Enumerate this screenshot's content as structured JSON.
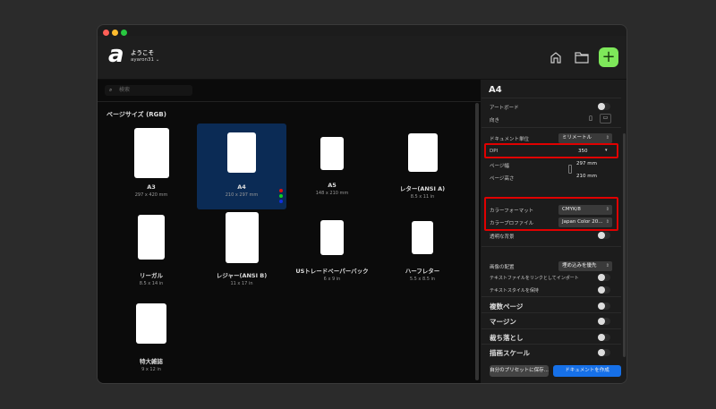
{
  "header": {
    "welcome": "ようこそ",
    "user": "ayaron31",
    "accent": "#7ee85a"
  },
  "search": {
    "placeholder": "検索"
  },
  "section": "ページサイズ (RGB)",
  "presets": [
    {
      "name": "A3",
      "size": "297 x 420 mm"
    },
    {
      "name": "A4",
      "size": "210 x 297 mm",
      "selected": true
    },
    {
      "name": "A5",
      "size": "148 x 210 mm"
    },
    {
      "name": "レター(ANSI A)",
      "size": "8.5 x 11 in"
    },
    {
      "name": "リーガル",
      "size": "8.5 x 14 in"
    },
    {
      "name": "レジャー(ANSI B)",
      "size": "11 x 17 in"
    },
    {
      "name": "USトレードペーパーバック",
      "size": "6 x 9 in"
    },
    {
      "name": "ハーフレター",
      "size": "5.5 x 8.5 in"
    },
    {
      "name": "特大雑誌",
      "size": "9 x 12 in"
    }
  ],
  "panel": {
    "title": "A4",
    "artboard": "アートボード",
    "orientation": "向き",
    "units_label": "ドキュメント単位",
    "units": "ミリメートル",
    "dpi_label": "DPI",
    "dpi": "350",
    "width_label": "ページ幅",
    "width": "297 mm",
    "height_label": "ページ高さ",
    "height": "210 mm",
    "color_format_label": "カラーフォーマット",
    "color_format": "CMYK/8",
    "color_profile_label": "カラープロファイル",
    "color_profile": "Japan Color 20...",
    "transparent_label": "透明な背景",
    "image_placement_label": "画像の配置",
    "image_placement": "埋め込みを優先",
    "link_text_label": "テキストファイルをリンクとしてインポート",
    "keep_style_label": "テキストスタイルを保持",
    "multi_page": "複数ページ",
    "margin": "マージン",
    "bleed": "裁ち落とし",
    "scale": "描画スケール",
    "save_preset": "自分のプリセットに保存...",
    "create": "ドキュメントを作成"
  }
}
